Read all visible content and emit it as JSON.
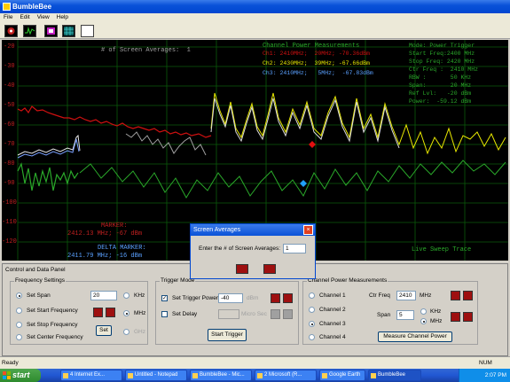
{
  "window": {
    "title": "BumbleBee"
  },
  "menu": [
    "File",
    "Edit",
    "View",
    "Help"
  ],
  "toolbar": {
    "icons": [
      "dial-icon",
      "waveform-icon",
      "scope-icon",
      "grid-icon",
      "blank-screen-icon"
    ]
  },
  "colors": {
    "trace_white": "#e8e8e8",
    "trace_green": "#2aa82a",
    "trace_yellow": "#e8e800",
    "trace_red": "#d01010",
    "grid": "#0a5a0a",
    "axis_text": "#c02020"
  },
  "screen": {
    "averages_label": "# of Screen Averages:  1",
    "axis_labels": [
      "-20",
      "-30",
      "-40",
      "-50",
      "-60",
      "-70",
      "-80",
      "-90",
      "-100",
      "-110",
      "-120"
    ],
    "channel_power": {
      "title": "Channel Power Measurements",
      "ch1": "Ch1: 2410MHz;  20MHz; -70.36dBm",
      "ch2": "Ch2: 2430MHz;  39MHz; -67.66dBm",
      "ch3": "Ch3: 2410MHz;   5MHz;  -67.83dBm"
    },
    "info": [
      "Mode: Power Trigger",
      "Start Freq:2400 MHz",
      "Stop Freq: 2420 MHz",
      "Ctr Freq :  2410 MHz",
      "RBW :       50 KHz",
      "Span:       20 MHz",
      "Ref Lvl:   -20 dBm",
      "Power:  -59.12 dBm"
    ],
    "marker_title": "MARKER:",
    "marker_value": "2412.13 MHz; -67 dBm",
    "delta_title": "DELTA MARKER:",
    "delta_value": "2411.79 MHz; -16 dBm",
    "live_sweep": "Live Sweep Trace"
  },
  "dialog": {
    "title": "Screen Averages",
    "prompt": "Enter the # of Screen Averages:",
    "value": "1"
  },
  "panel": {
    "title": "Control and Data Panel",
    "freq": {
      "title": "Frequency Settings",
      "options": [
        "Set Span",
        "Set Start Frequency",
        "Set Stop Frequency",
        "Set Center Frequency"
      ],
      "selected": "Set Span",
      "value": "20",
      "set_label": "Set",
      "units": [
        "KHz",
        "MHz",
        "GHz"
      ]
    },
    "trigger": {
      "title": "Trigger Mode",
      "power_label": "Set Trigger Power",
      "power_value": "-40",
      "power_unit": "dBm",
      "delay_label": "Set Delay",
      "delay_unit": "Micro Sec",
      "start_label": "Start Trigger"
    },
    "cpm": {
      "title": "Channel Power Measurements",
      "channels": [
        "Channel 1",
        "Channel 2",
        "Channel 3",
        "Channel 4"
      ],
      "selected": "Channel 3",
      "ctr_label": "Ctr Freq",
      "ctr_value": "2410",
      "ctr_unit": "MHz",
      "span_label": "Span",
      "span_value": "5",
      "span_units": [
        "KHz",
        "MHz"
      ],
      "measure_label": "Measure Channel Power"
    }
  },
  "status": {
    "left": "Ready",
    "right": "NUM"
  },
  "taskbar": {
    "start": "start",
    "tasks": [
      "4 Internet Ex...",
      "Untitled - Notepad",
      "BumbleBee - Mic...",
      "2 Microsoft (R...",
      "Google Earth",
      "BumbleBee"
    ],
    "active": "BumbleBee",
    "clock": "2:07 PM"
  }
}
